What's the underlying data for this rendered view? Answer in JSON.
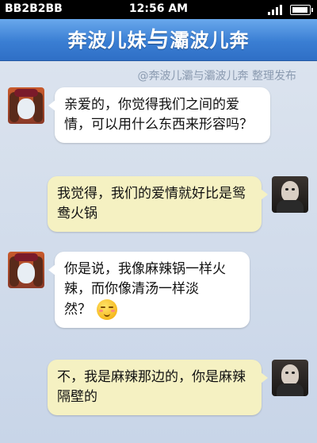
{
  "status": {
    "carrier": "BB2B2BB",
    "time": "12:56 AM"
  },
  "header": {
    "left": "奔波儿妹",
    "with": "与",
    "right": "灞波儿奔"
  },
  "watermark": "@奔波儿灞与灞波儿奔 整理发布",
  "messages": [
    {
      "side": "left",
      "text": "亲爱的，你觉得我们之间的爱情，可以用什么东西来形容吗？"
    },
    {
      "side": "right",
      "text": "我觉得，我们的爱情就好比是鸳鸯火锅"
    },
    {
      "side": "left",
      "line1": "你是说，我像麻辣锅一样火辣，而你像清汤一样淡",
      "line2": "然？",
      "emoji": "blushing-face-icon"
    },
    {
      "side": "right",
      "text": "不，我是麻辣那边的，你是麻辣隔壁的"
    }
  ]
}
